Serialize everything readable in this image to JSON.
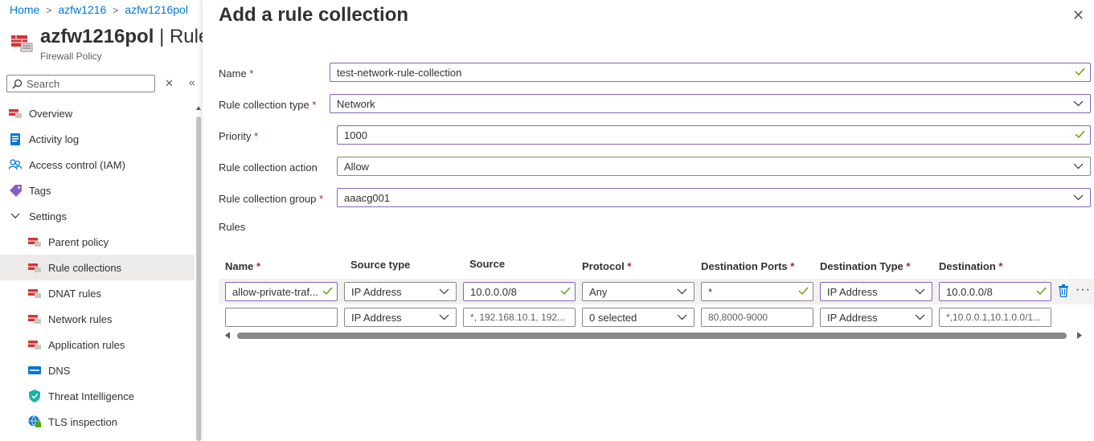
{
  "breadcrumb": {
    "home": "Home",
    "firewall": "azfw1216",
    "policy": "azfw1216pol"
  },
  "resource": {
    "title": "azfw1216pol",
    "title_rest": "| Rule",
    "subtitle": "Firewall Policy"
  },
  "search": {
    "placeholder": "Search"
  },
  "nav": {
    "overview": "Overview",
    "activity_log": "Activity log",
    "access_control": "Access control (IAM)",
    "tags": "Tags",
    "settings": "Settings",
    "parent_policy": "Parent policy",
    "rule_collections": "Rule collections",
    "dnat_rules": "DNAT rules",
    "network_rules": "Network rules",
    "application_rules": "Application rules",
    "dns": "DNS",
    "threat_intelligence": "Threat Intelligence",
    "tls_inspection": "TLS inspection"
  },
  "panel": {
    "title": "Add a rule collection",
    "name_label": "Name",
    "name_value": "test-network-rule-collection",
    "type_label": "Rule collection type",
    "type_value": "Network",
    "priority_label": "Priority",
    "priority_value": "1000",
    "action_label": "Rule collection action",
    "action_value": "Allow",
    "group_label": "Rule collection group",
    "group_value": "aaacg001",
    "rules_label": "Rules",
    "required_mark": "*"
  },
  "rules_grid": {
    "headers": {
      "name": "Name",
      "source_type": "Source type",
      "source": "Source",
      "protocol": "Protocol",
      "destination_ports": "Destination Ports",
      "destination_type": "Destination Type",
      "destination": "Destination"
    },
    "rows": [
      {
        "name": "allow-private-traf...",
        "source_type": "IP Address",
        "source": "10.0.0.0/8",
        "protocol": "Any",
        "destination_ports": "*",
        "destination_type": "IP Address",
        "destination": "10.0.0.0/8"
      },
      {
        "name": "",
        "source_type": "IP Address",
        "source_placeholder": "*, 192.168.10.1, 192...",
        "protocol": "0 selected",
        "destination_ports_placeholder": "80,8000-9000",
        "destination_type": "IP Address",
        "destination_placeholder": "*,10.0.0.1,10.1.0.0/1..."
      }
    ],
    "more_label": "···"
  },
  "colors": {
    "accent": "#0078d4",
    "valid_border": "#8764b8",
    "check": "#57a300",
    "required": "#a4262c",
    "firewall_red": "#d13438"
  }
}
